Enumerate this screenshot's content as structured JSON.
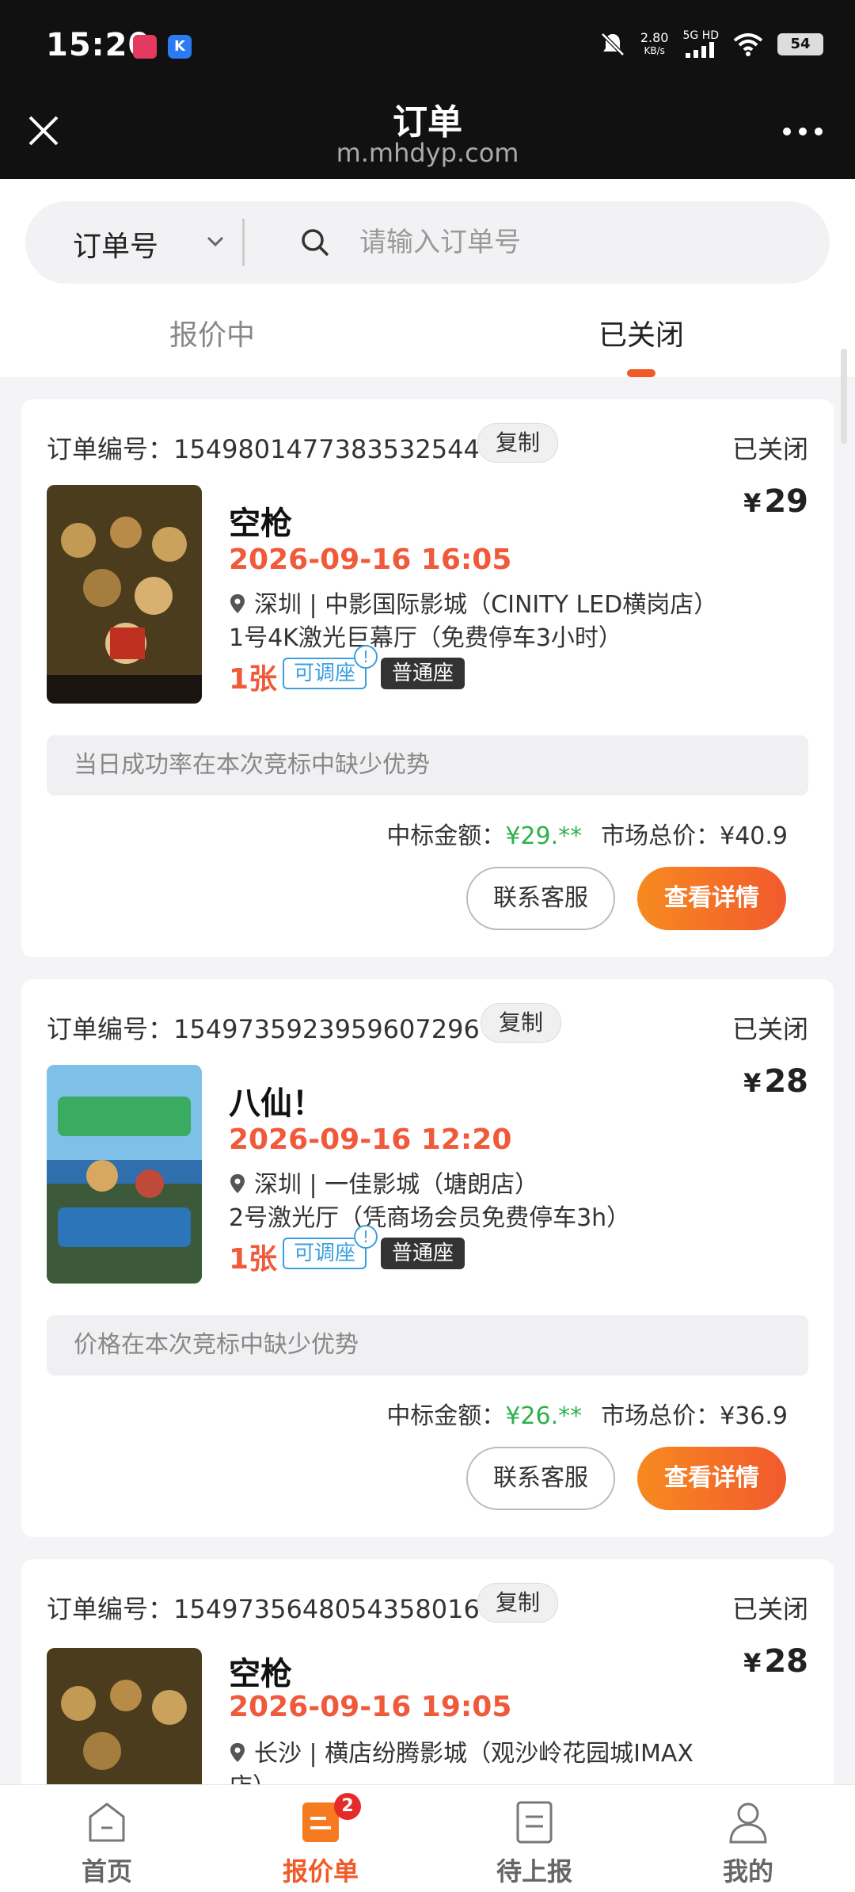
{
  "status_bar": {
    "time": "15:20",
    "net_speed": "2.80",
    "net_unit": "KB/s",
    "network": "5G HD",
    "battery": "54",
    "app_badge": "K"
  },
  "header": {
    "title": "订单",
    "subtitle": "m.mhdyp.com"
  },
  "search": {
    "type_label": "订单号",
    "placeholder": "请输入订单号"
  },
  "tabs": [
    {
      "label": "报价中"
    },
    {
      "label": "已关闭"
    }
  ],
  "orders": [
    {
      "order_label": "订单编号：1549801477383532544",
      "copy": "复制",
      "status": "已关闭",
      "movie": "空枪",
      "price_symbol": "¥",
      "price": "29",
      "showtime": "2026-09-16 16:05",
      "location": "深圳 | 中影国际影城（CINITY LED横岗店）",
      "hall": "1号4K激光巨幕厅（免费停车3小时）",
      "qty": "1张",
      "tag_adjust": "可调座",
      "tag_seat": "普通座",
      "reason": "当日成功率在本次竞标中缺少优势",
      "win_label": "中标金额：",
      "win_value": "¥29.**",
      "market_label": "市场总价：",
      "market_value": "¥40.9",
      "btn_service": "联系客服",
      "btn_detail": "查看详情"
    },
    {
      "order_label": "订单编号：1549735923959607296",
      "copy": "复制",
      "status": "已关闭",
      "movie": "八仙！",
      "price_symbol": "¥",
      "price": "28",
      "showtime": "2026-09-16 12:20",
      "location": "深圳 | 一佳影城（塘朗店）",
      "hall": "2号激光厅（凭商场会员免费停车3h）",
      "qty": "1张",
      "tag_adjust": "可调座",
      "tag_seat": "普通座",
      "reason": "价格在本次竞标中缺少优势",
      "win_label": "中标金额：",
      "win_value": "¥26.**",
      "market_label": "市场总价：",
      "market_value": "¥36.9",
      "btn_service": "联系客服",
      "btn_detail": "查看详情"
    },
    {
      "order_label": "订单编号：1549735648054358016",
      "copy": "复制",
      "status": "已关闭",
      "movie": "空枪",
      "price_symbol": "¥",
      "price": "28",
      "showtime": "2026-09-16 19:05",
      "location": "长沙 | 横店纷腾影城（观沙岭花园城IMAX",
      "location_line2": "店）"
    }
  ],
  "bottom_nav": [
    {
      "label": "首页"
    },
    {
      "label": "报价单",
      "badge": "2"
    },
    {
      "label": "待上报"
    },
    {
      "label": "我的"
    }
  ],
  "colors": {
    "accent": "#f05a28",
    "win_green": "#2fb04a",
    "time_red": "#f05a3a"
  }
}
